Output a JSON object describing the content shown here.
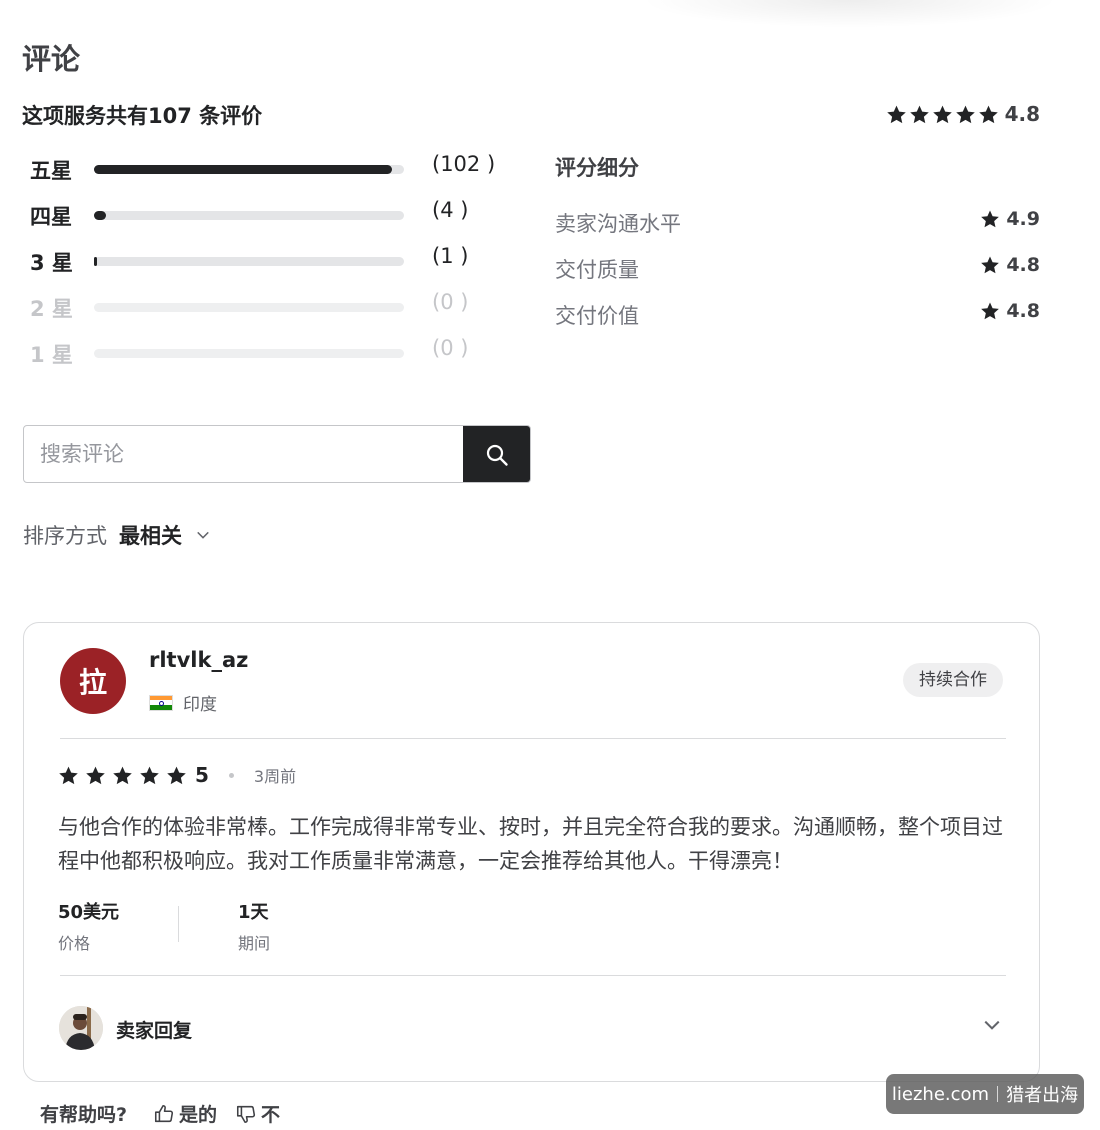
{
  "header": {
    "title": "评论",
    "summary": "这项服务共有107 条评价",
    "overall_rating": "4.8"
  },
  "breakdown": [
    {
      "label": "五星",
      "count_text": "(102 )",
      "count": 102,
      "fraction": 0.96
    },
    {
      "label": "四星",
      "count_text": "(4 )",
      "count": 4,
      "fraction": 0.04
    },
    {
      "label": "3 星",
      "count_text": "(1 )",
      "count": 1,
      "fraction": 0.01
    },
    {
      "label": "2 星",
      "count_text": "(0 )",
      "count": 0,
      "fraction": 0
    },
    {
      "label": "1 星",
      "count_text": "(0 )",
      "count": 0,
      "fraction": 0
    }
  ],
  "rating_breakdown": {
    "title": "评分细分",
    "items": [
      {
        "label": "卖家沟通水平",
        "score": "4.9"
      },
      {
        "label": "交付质量",
        "score": "4.8"
      },
      {
        "label": "交付价值",
        "score": "4.8"
      }
    ]
  },
  "search": {
    "placeholder": "搜索评论",
    "value": ""
  },
  "sort": {
    "label": "排序方式",
    "value": "最相关"
  },
  "review": {
    "avatar_letter": "拉",
    "avatar_color": "#9b2226",
    "username": "rltvlk_az",
    "country": "印度",
    "badge": "持续合作",
    "rating": "5",
    "time": "3周前",
    "text": "与他合作的体验非常棒。工作完成得非常专业、按时，并且完全符合我的要求。沟通顺畅，整个项目过程中他都积极响应。我对工作质量非常满意，一定会推荐给其他人。干得漂亮！",
    "price_value": "50美元",
    "price_label": "价格",
    "duration_value": "1天",
    "duration_label": "期间",
    "seller_reply": "卖家回复"
  },
  "helpful": {
    "label": "有帮助吗?",
    "yes": "是的",
    "no": "不"
  },
  "watermark": {
    "left": "liezhe.com",
    "right": "猎者出海"
  }
}
